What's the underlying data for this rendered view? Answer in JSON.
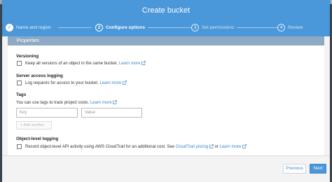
{
  "modal": {
    "title": "Create bucket"
  },
  "steps": [
    {
      "number": "✓",
      "label": "Name and region",
      "state": "done"
    },
    {
      "number": "2",
      "label": "Configure options",
      "state": "active"
    },
    {
      "number": "3",
      "label": "Set permissions",
      "state": "pending"
    },
    {
      "number": "4",
      "label": "Review",
      "state": "pending"
    }
  ],
  "properties": {
    "title": "Properties"
  },
  "versioning": {
    "title": "Versioning",
    "checkbox_label": "Keep all versions of an object in the same bucket.",
    "learn_more": "Learn more"
  },
  "access_logging": {
    "title": "Server access logging",
    "checkbox_label": "Log requests for access to your bucket.",
    "learn_more": "Learn more"
  },
  "tags": {
    "title": "Tags",
    "description": "You can use tags to track project costs.",
    "learn_more": "Learn more",
    "key_placeholder": "Key",
    "value_placeholder": "Value",
    "add_another": "+ Add another"
  },
  "object_logging": {
    "title": "Object-level logging",
    "checkbox_label": "Record object-level API activity using AWS CloudTrail for an additional cost. See",
    "pricing_link": "CloudTrail pricing",
    "or_text": "or",
    "learn_more": "Learn more"
  },
  "footer": {
    "previous_label": "Previous",
    "next_label": "Next"
  },
  "colors": {
    "header_blue": "#4a97d9",
    "properties_bar": "#8ea9c4",
    "link_blue": "#3b86c8",
    "backdrop": "#3f4b5b"
  },
  "icons": {
    "external_link": "external-link-icon",
    "step_done": "checkmark-icon"
  }
}
